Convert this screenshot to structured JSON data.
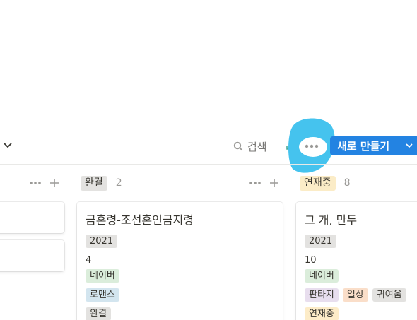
{
  "toolbar": {
    "search_label": "검색",
    "new_label": "새로 만들기",
    "accent_color": "#2383e2",
    "highlight_color": "#45c3ee"
  },
  "board": {
    "columns": [
      {
        "name": "",
        "cards": []
      },
      {
        "name": "완결",
        "count": "2",
        "tag_color": "#e3e2e0",
        "cards": [
          {
            "title": "금혼령-조선혼인금지령",
            "year": "2021",
            "number": "4",
            "platform": "네이버",
            "genres": [
              "로맨스"
            ],
            "status": "완결"
          }
        ]
      },
      {
        "name": "연재중",
        "count": "8",
        "tag_color": "#fbecc7",
        "cards": [
          {
            "title": "그 개, 만두",
            "year": "2021",
            "number": "10",
            "platform": "네이버",
            "genres": [
              "판타지",
              "일상",
              "귀여움"
            ],
            "status": "연재중"
          }
        ]
      }
    ]
  },
  "tag_colors": {
    "gray": "#e3e2e0",
    "green": "#dbeddb",
    "teal": "#d3e5ef",
    "purple": "#e8deee",
    "orange": "#fadec9",
    "yellow": "#fdecc8"
  }
}
